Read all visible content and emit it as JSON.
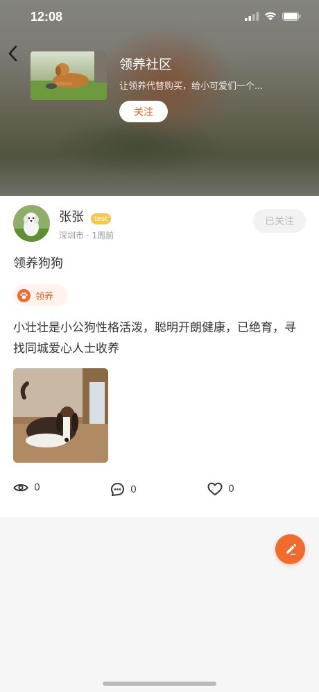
{
  "status_bar": {
    "time": "12:08"
  },
  "community": {
    "title": "领养社区",
    "description": "让领养代替购买，给小可爱们一个...",
    "follow_label": "关注"
  },
  "post": {
    "author": {
      "name": "张张",
      "tag": "test",
      "location": "深圳市",
      "time_ago": "1周前"
    },
    "followed_label": "已关注",
    "title": "领养狗狗",
    "topic": {
      "label": "领养",
      "icon": "paw-icon"
    },
    "body": "小壮壮是小公狗性格活泼，聪明开朗健康，已绝育，寻找同城爱心人士收养",
    "stats": {
      "views": "0",
      "comments": "0",
      "likes": "0"
    }
  },
  "colors": {
    "accent": "#ef6b2e",
    "tag": "#f6c74b",
    "chip_bg": "#fff3ee"
  }
}
